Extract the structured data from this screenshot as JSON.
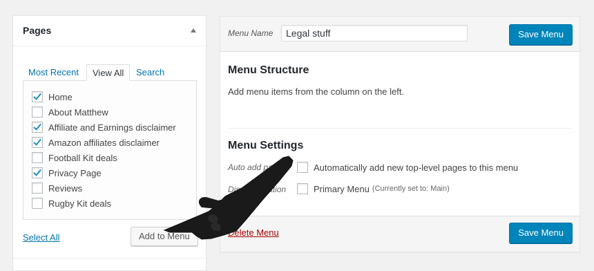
{
  "pages_box": {
    "title": "Pages",
    "tabs": [
      {
        "label": "Most Recent",
        "active": false
      },
      {
        "label": "View All",
        "active": true
      },
      {
        "label": "Search",
        "active": false
      }
    ],
    "items": [
      {
        "label": "Home",
        "checked": true
      },
      {
        "label": "About Matthew",
        "checked": false
      },
      {
        "label": "Affiliate and Earnings disclaimer",
        "checked": true
      },
      {
        "label": "Amazon affiliates disclaimer",
        "checked": true
      },
      {
        "label": "Football Kit deals",
        "checked": false
      },
      {
        "label": "Privacy Page",
        "checked": true
      },
      {
        "label": "Reviews",
        "checked": false
      },
      {
        "label": "Rugby Kit deals",
        "checked": false
      }
    ],
    "select_all": "Select All",
    "add_button": "Add to Menu"
  },
  "menu_editor": {
    "name_label": "Menu Name",
    "name_value": "Legal stuff",
    "save_label": "Save Menu",
    "structure_title": "Menu Structure",
    "structure_desc": "Add menu items from the column on the left.",
    "settings_title": "Menu Settings",
    "auto_add_label": "Auto add pages",
    "auto_add_option": "Automatically add new top-level pages to this menu",
    "display_label": "Display location",
    "display_option": "Primary Menu",
    "display_note": "(Currently set to: Main)",
    "delete_label": "Delete Menu"
  },
  "colors": {
    "primary_button": "#0085ba",
    "link": "#0073aa",
    "delete": "#a00",
    "checkmark": "#1e8cbe"
  }
}
